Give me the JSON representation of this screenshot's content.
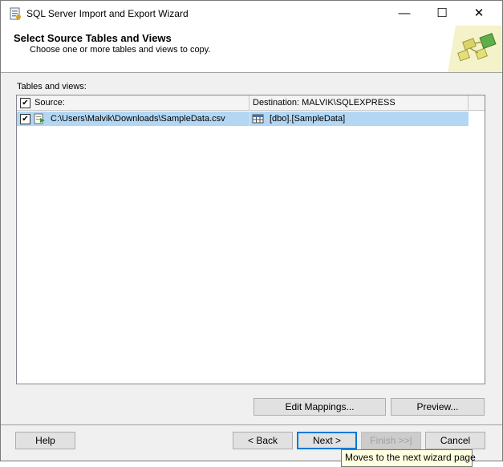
{
  "window": {
    "title": "SQL Server Import and Export Wizard",
    "controls": {
      "minimize": "—",
      "maximize": "☐",
      "close": "✕"
    }
  },
  "header": {
    "title": "Select Source Tables and Views",
    "subtitle": "Choose one or more tables and views to copy."
  },
  "tables": {
    "label": "Tables and views:",
    "columns": {
      "source": "Source:",
      "destination": "Destination: MALVIK\\SQLEXPRESS"
    },
    "rows": [
      {
        "checked": true,
        "source": "C:\\Users\\Malvik\\Downloads\\SampleData.csv",
        "destination": "[dbo].[SampleData]"
      }
    ]
  },
  "buttons": {
    "edit_mappings": "Edit Mappings...",
    "preview": "Preview...",
    "help": "Help",
    "back": "< Back",
    "next": "Next >",
    "finish": "Finish >>|",
    "cancel": "Cancel"
  },
  "tooltip": "Moves to the next wizard page",
  "colors": {
    "row_selected": "#b3d7f3",
    "focus_border": "#0078d7",
    "tooltip_bg": "#ffffe1"
  }
}
